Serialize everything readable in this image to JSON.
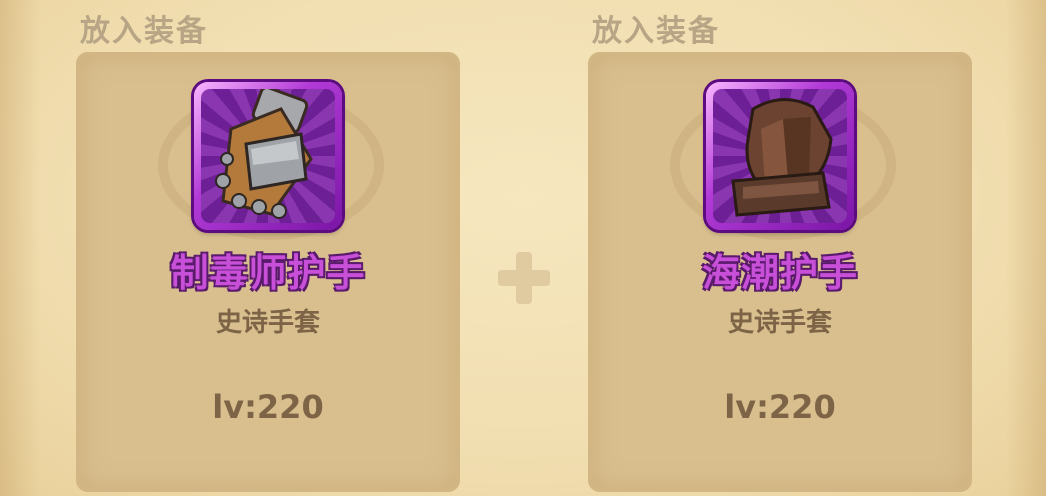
{
  "slots": [
    {
      "header": "放入装备",
      "item": {
        "name": "制毒师护手",
        "type": "史诗手套",
        "level": "lv:220",
        "icon": "armored-gauntlet-icon"
      }
    },
    {
      "header": "放入装备",
      "item": {
        "name": "海潮护手",
        "type": "史诗手套",
        "level": "lv:220",
        "icon": "leather-glove-icon"
      }
    }
  ],
  "combine_icon": "plus-icon",
  "colors": {
    "epic_rarity": "#c84fd8",
    "panel": "#d9bf8e",
    "background": "#f1deb0",
    "muted_text": "#7d6446"
  }
}
